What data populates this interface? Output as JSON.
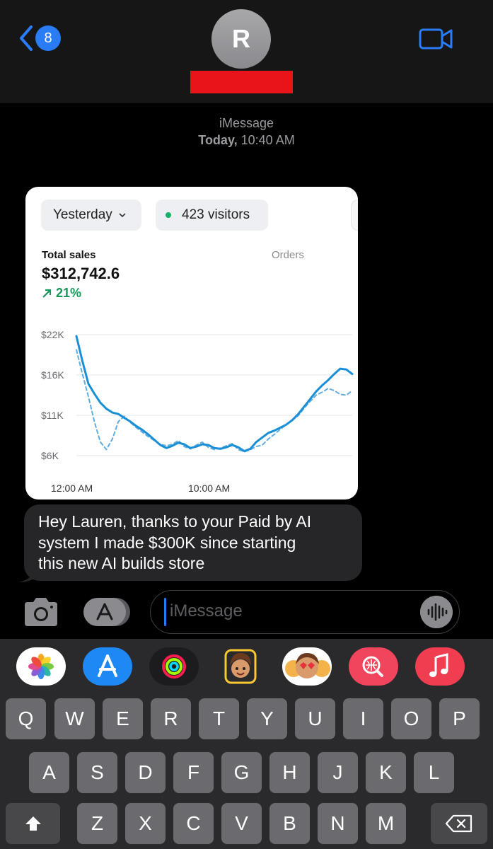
{
  "header": {
    "back_count": "8",
    "avatar_initial": "R",
    "icons": {
      "back": "chevron-left-icon",
      "video": "video-camera-icon"
    },
    "colors": {
      "accent": "#2a7cf6",
      "redaction": "#e8141a"
    }
  },
  "conversation": {
    "service": "iMessage",
    "day": "Today,",
    "time": "10:40 AM"
  },
  "image_card": {
    "date_filter": "Yesterday",
    "visitors": "423 visitors",
    "total_sales_label": "Total sales",
    "orders_label": "Orders",
    "total_sales_value": "$312,742.6",
    "growth": "21%"
  },
  "chart_data": {
    "type": "line",
    "y_ticks": [
      "$22K",
      "$16K",
      "$11K",
      "$6K"
    ],
    "x_ticks": [
      "12:00 AM",
      "10:00 AM"
    ],
    "ylim": [
      6000,
      22000
    ],
    "grid": true,
    "series": [
      {
        "style": "solid",
        "color": "#1b8fd6",
        "values": [
          21800,
          18500,
          15500,
          14200,
          13000,
          12200,
          11700,
          11500,
          11000,
          10500,
          9900,
          9400,
          8800,
          8100,
          7400,
          7000,
          7300,
          7700,
          7500,
          7000,
          7200,
          7500,
          7400,
          7000,
          6900,
          7100,
          7400,
          7100,
          6600,
          6900,
          7800,
          8400,
          9000,
          9300,
          9700,
          10100,
          10700,
          11500,
          12500,
          13500,
          14500,
          15300,
          16000,
          16800,
          17500,
          17400,
          16800
        ]
      },
      {
        "style": "dashed",
        "color": "#5faee2",
        "values": [
          20000,
          16800,
          13800,
          10500,
          7800,
          6800,
          8200,
          10500,
          11200,
          10400,
          9700,
          9100,
          8500,
          8000,
          7500,
          7300,
          7500,
          8000,
          7200,
          6900,
          7400,
          7800,
          7100,
          6800,
          7000,
          7300,
          7600,
          6800,
          6500,
          6800,
          7200,
          7400,
          8200,
          8800,
          9500,
          10100,
          10700,
          11300,
          12300,
          13200,
          14000,
          14400,
          14900,
          14600,
          14100,
          14000,
          14600
        ]
      }
    ]
  },
  "message": {
    "lines": [
      "Hey Lauren, thanks to your Paid by AI",
      "system I made $300K since starting",
      "this new AI builds store"
    ]
  },
  "compose": {
    "placeholder": "iMessage"
  },
  "app_tray": [
    "photos-app-icon",
    "app-store-icon",
    "activity-rings-icon",
    "memoji-icon",
    "memoji-stickers-icon",
    "image-search-icon",
    "music-app-icon"
  ],
  "keyboard": {
    "row1": [
      "Q",
      "W",
      "E",
      "R",
      "T",
      "Y",
      "U",
      "I",
      "O",
      "P"
    ],
    "row2": [
      "A",
      "S",
      "D",
      "F",
      "G",
      "H",
      "J",
      "K",
      "L"
    ],
    "row3": [
      "Z",
      "X",
      "C",
      "V",
      "B",
      "N",
      "M"
    ]
  }
}
